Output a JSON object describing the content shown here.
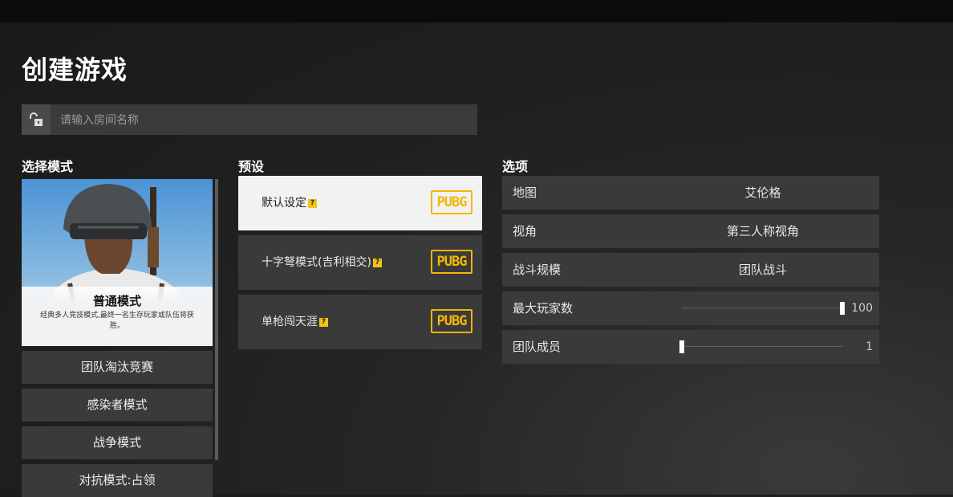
{
  "header": {
    "title": "创建游戏"
  },
  "search": {
    "placeholder": "请输入房间名称"
  },
  "sections": {
    "mode": "选择模式",
    "preset": "预设",
    "options": "选项"
  },
  "mode_card": {
    "name": "普通模式",
    "description": "经典多人竞技模式,最终一名生存玩家或队伍将获胜。"
  },
  "modes": [
    "团队淘汰竞赛",
    "感染者模式",
    "战争模式",
    "对抗模式:占领"
  ],
  "presets": [
    {
      "label": "默认设定",
      "help": "?",
      "logo": "PUBG",
      "selected": true
    },
    {
      "label": "十字弩模式(吉利相交)",
      "help": "?",
      "logo": "PUBG",
      "selected": false
    },
    {
      "label": "单枪闯天涯",
      "help": "?",
      "logo": "PUBG",
      "selected": false
    }
  ],
  "options": {
    "map": {
      "label": "地图",
      "value": "艾伦格"
    },
    "perspective": {
      "label": "视角",
      "value": "第三人称视角"
    },
    "scale": {
      "label": "战斗规模",
      "value": "团队战斗"
    },
    "max_players": {
      "label": "最大玩家数",
      "value": "100",
      "slider_fraction": 1.0
    },
    "team_size": {
      "label": "团队成员",
      "value": "1",
      "slider_fraction": 0.0
    }
  },
  "icons": {
    "lock": "unlocked-lock-icon",
    "help": "question-icon",
    "logo": "pubg-logo"
  },
  "colors": {
    "accent": "#f2b705",
    "panel": "#3a3a3a",
    "selected": "#f2f2f2"
  }
}
